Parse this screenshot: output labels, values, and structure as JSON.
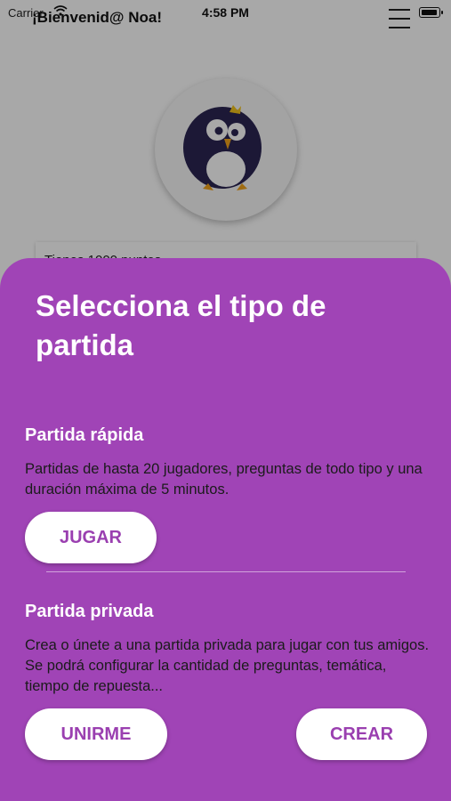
{
  "status_bar": {
    "carrier": "Carrier",
    "time": "4:58 PM"
  },
  "header": {
    "greeting": "¡Bienvenid@ Noa!",
    "menu_icon": "hamburger-menu-icon"
  },
  "profile": {
    "avatar_icon": "penguin-avatar-icon",
    "points_text": "Tienes 1000 puntos"
  },
  "sheet": {
    "title": "Selecciona el tipo de partida",
    "quick": {
      "title": "Partida rápida",
      "description": "Partidas de hasta 20 jugadores, preguntas de todo tipo y una duración máxima de 5 minutos.",
      "play_label": "JUGAR"
    },
    "private": {
      "title": "Partida privada",
      "description": "Crea o únete a una partida privada para jugar con tus amigos. Se podrá configurar la cantidad de preguntas, temática, tiempo de repuesta...",
      "join_label": "UNIRME",
      "create_label": "CREAR"
    }
  },
  "colors": {
    "sheet": "#a044b6",
    "button_text": "#9a3fb0",
    "button_bg": "#ffffff"
  }
}
